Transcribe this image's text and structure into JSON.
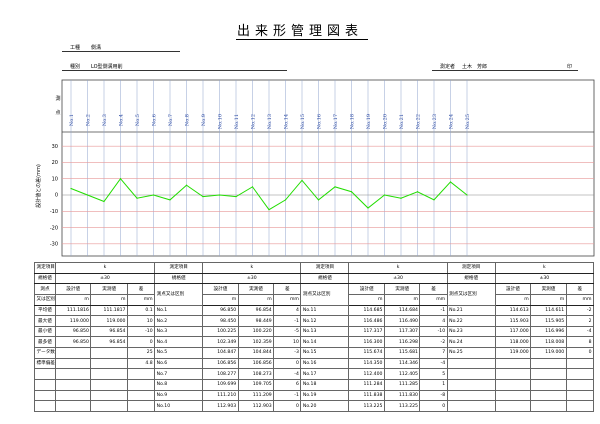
{
  "title": "出来形管理図表",
  "header": {
    "kouji_label": "工種",
    "kouji_value": "側溝",
    "shubetsu_label": "種別",
    "shubetsu_value": "LO型側溝用削",
    "sokuteisha_label": "測定者",
    "sokuteisha_value": "土木　芳郎",
    "page_mark": "印"
  },
  "chart_data": {
    "type": "line",
    "x_labels": [
      "No.1",
      "No.2",
      "No.3",
      "No.4",
      "No.5",
      "No.6",
      "No.7",
      "No.8",
      "No.9",
      "No.10",
      "No.11",
      "No.12",
      "No.13",
      "No.14",
      "No.15",
      "No.16",
      "No.17",
      "No.18",
      "No.19",
      "No.20",
      "No.21",
      "No.22",
      "No.23",
      "No.24",
      "No.25"
    ],
    "values": [
      4,
      0,
      -4,
      10,
      -2,
      0,
      -3,
      6,
      -1,
      0,
      -1,
      5,
      -9,
      -3,
      9,
      -3,
      5,
      2,
      -8,
      0,
      -2,
      2,
      -3,
      8,
      0
    ],
    "ylim": [
      -35,
      35
    ],
    "yticks": [
      30,
      20,
      10,
      0,
      -10,
      -20,
      -30
    ],
    "ylabel": "設計値との差(mm)",
    "top_axis_label_1": "測",
    "top_axis_label_2": "点",
    "line_color": "#22dd00",
    "grid_red": "#e89898",
    "grid_blue": "#8fa3cc"
  },
  "table": {
    "blocks": [
      {
        "hdr1": "測定項目",
        "val1": "k",
        "hdr2": "規格値",
        "val2": "±30",
        "measure_label": "測点",
        "col_design": "設計値",
        "col_actual": "実測値",
        "col_diff": "差",
        "unit_m": "m",
        "unit_mm": "mm",
        "sub_label": "又は区別",
        "stats": [
          {
            "label": "平均値",
            "design": "111.1816",
            "actual": "111.1817",
            "diff": "0.1"
          },
          {
            "label": "最大値",
            "design": "119.000",
            "actual": "119.000",
            "diff": "10"
          },
          {
            "label": "最小値",
            "design": "96.850",
            "actual": "96.854",
            "diff": "-10"
          },
          {
            "label": "最多値",
            "design": "96.850",
            "actual": "96.854",
            "diff": "0"
          },
          {
            "label": "データ数",
            "design": "",
            "actual": "",
            "diff": "25"
          },
          {
            "label": "標準偏差",
            "design": "",
            "actual": "",
            "diff": "4.8"
          }
        ]
      },
      {
        "hdr1": "測定項目",
        "val1": "k",
        "hdr2": "規格値",
        "val2": "±30",
        "measure_label": "測点又は区別",
        "col_design": "設計値",
        "col_actual": "実測値",
        "col_diff": "差",
        "unit_m": "m",
        "unit_mm": "mm",
        "rows": [
          {
            "no": "No.1",
            "design": "96.850",
            "actual": "96.854",
            "diff": "4"
          },
          {
            "no": "No.2",
            "design": "98.450",
            "actual": "98.449",
            "diff": "-1"
          },
          {
            "no": "No.3",
            "design": "100.225",
            "actual": "100.220",
            "diff": "-5"
          },
          {
            "no": "No.4",
            "design": "102.349",
            "actual": "102.359",
            "diff": "10"
          },
          {
            "no": "No.5",
            "design": "104.847",
            "actual": "104.844",
            "diff": "-3"
          },
          {
            "no": "No.6",
            "design": "106.856",
            "actual": "106.856",
            "diff": "0"
          },
          {
            "no": "No.7",
            "design": "108.277",
            "actual": "108.273",
            "diff": "-4"
          },
          {
            "no": "No.8",
            "design": "109.699",
            "actual": "109.705",
            "diff": "6"
          },
          {
            "no": "No.9",
            "design": "111.210",
            "actual": "111.209",
            "diff": "-1"
          },
          {
            "no": "No.10",
            "design": "112.903",
            "actual": "112.903",
            "diff": "0"
          }
        ]
      },
      {
        "hdr1": "測定項目",
        "val1": "k",
        "hdr2": "規格値",
        "val2": "±30",
        "measure_label": "測点又は区別",
        "col_design": "設計値",
        "col_actual": "実測値",
        "col_diff": "差",
        "unit_m": "m",
        "unit_mm": "mm",
        "rows": [
          {
            "no": "No.11",
            "design": "114.685",
            "actual": "114.684",
            "diff": "-1"
          },
          {
            "no": "No.12",
            "design": "116.486",
            "actual": "116.490",
            "diff": "4"
          },
          {
            "no": "No.13",
            "design": "117.317",
            "actual": "117.307",
            "diff": "-10"
          },
          {
            "no": "No.14",
            "design": "116.300",
            "actual": "116.298",
            "diff": "-2"
          },
          {
            "no": "No.15",
            "design": "115.674",
            "actual": "115.681",
            "diff": "7"
          },
          {
            "no": "No.16",
            "design": "114.350",
            "actual": "114.346",
            "diff": "-4"
          },
          {
            "no": "No.17",
            "design": "112.400",
            "actual": "112.405",
            "diff": "5"
          },
          {
            "no": "No.18",
            "design": "111.284",
            "actual": "111.285",
            "diff": "1"
          },
          {
            "no": "No.19",
            "design": "111.838",
            "actual": "111.830",
            "diff": "-8"
          },
          {
            "no": "No.20",
            "design": "113.225",
            "actual": "113.225",
            "diff": "0"
          }
        ]
      },
      {
        "hdr1": "測定項目",
        "val1": "k",
        "hdr2": "規格値",
        "val2": "±30",
        "measure_label": "測点又は区別",
        "col_design": "設計値",
        "col_actual": "実測値",
        "col_diff": "差",
        "unit_m": "m",
        "unit_mm": "mm",
        "rows": [
          {
            "no": "No.21",
            "design": "114.613",
            "actual": "114.611",
            "diff": "-2"
          },
          {
            "no": "No.22",
            "design": "115.903",
            "actual": "115.905",
            "diff": "2"
          },
          {
            "no": "No.23",
            "design": "117.000",
            "actual": "116.996",
            "diff": "-4"
          },
          {
            "no": "No.24",
            "design": "118.000",
            "actual": "118.008",
            "diff": "8"
          },
          {
            "no": "No.25",
            "design": "119.000",
            "actual": "119.000",
            "diff": "0"
          },
          {
            "no": "",
            "design": "",
            "actual": "",
            "diff": ""
          },
          {
            "no": "",
            "design": "",
            "actual": "",
            "diff": ""
          },
          {
            "no": "",
            "design": "",
            "actual": "",
            "diff": ""
          },
          {
            "no": "",
            "design": "",
            "actual": "",
            "diff": ""
          },
          {
            "no": "",
            "design": "",
            "actual": "",
            "diff": ""
          }
        ]
      }
    ]
  }
}
